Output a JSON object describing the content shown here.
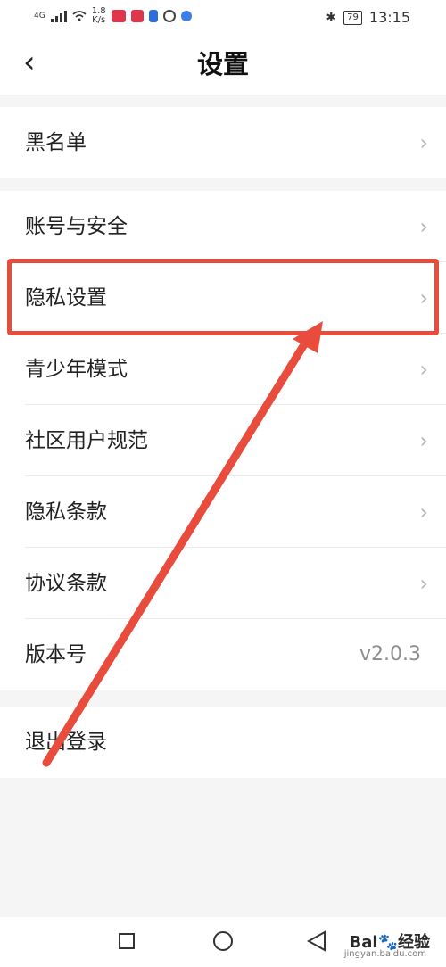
{
  "status_bar": {
    "network": "4G",
    "speed_value": "1.8",
    "speed_unit": "K/s",
    "battery": "79",
    "time": "13:15"
  },
  "header": {
    "title": "设置",
    "back_icon": "chevron-left-icon"
  },
  "sections": [
    {
      "items": [
        {
          "label": "黑名单"
        }
      ]
    },
    {
      "items": [
        {
          "label": "账号与安全"
        },
        {
          "label": "隐私设置"
        },
        {
          "label": "青少年模式"
        },
        {
          "label": "社区用户规范"
        },
        {
          "label": "隐私条款"
        },
        {
          "label": "协议条款"
        },
        {
          "label": "版本号",
          "value": "v2.0.3"
        }
      ]
    },
    {
      "items": [
        {
          "label": "退出登录"
        }
      ]
    }
  ],
  "annotation": {
    "highlight_color": "#e84c3d",
    "highlighted_item": "隐私设置"
  },
  "watermark": {
    "brand": "Bai",
    "brand_suffix": "经验",
    "url": "jingyan.baidu.com"
  }
}
